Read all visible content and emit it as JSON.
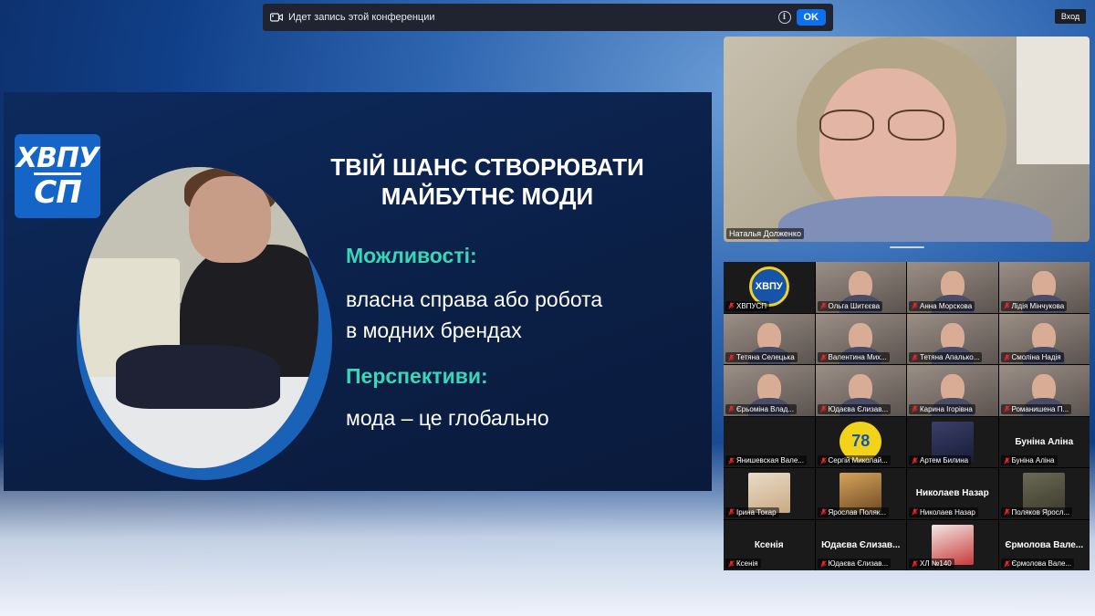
{
  "banner": {
    "text": "Идет запись этой конференции",
    "ok_label": "OK"
  },
  "login_label": "Вход",
  "slide": {
    "logo_line1": "ХВПУ",
    "logo_line2": "СП",
    "title_line1": "Твій шанс створювати",
    "title_line2": "майбутнє моди",
    "heading1": "Можливості:",
    "text1_line1": "власна справа або робота",
    "text1_line2": "в модних брендах",
    "heading2": "Перспективи:",
    "text2": "мода – це глобально"
  },
  "speaker": {
    "name": "Наталья Долженко"
  },
  "gallery": [
    {
      "name": "ХВПУСП",
      "kind": "logo"
    },
    {
      "name": "Ольга Шитєєва",
      "kind": "photo"
    },
    {
      "name": "Анна Морскова",
      "kind": "photo"
    },
    {
      "name": "Лідія Мінчукова",
      "kind": "photo"
    },
    {
      "name": "Тетяна Селецька",
      "kind": "photo"
    },
    {
      "name": "Валентина Мих...",
      "kind": "photo"
    },
    {
      "name": "Тетяна Апалько...",
      "kind": "photo"
    },
    {
      "name": "Смоліна Надія",
      "kind": "photo"
    },
    {
      "name": "Єрьоміна Влад...",
      "kind": "photo"
    },
    {
      "name": "Юдаєва Єлизав...",
      "kind": "photo"
    },
    {
      "name": "Карина Ігорівна",
      "kind": "photo"
    },
    {
      "name": "Романишена П...",
      "kind": "photo"
    },
    {
      "name": "Янишевская Вале...",
      "kind": "blank"
    },
    {
      "name": "Сергій Миколай...",
      "kind": "badge",
      "badge_text": "78"
    },
    {
      "name": "Артем Билина",
      "kind": "wolf"
    },
    {
      "name": "Буніна Аліна",
      "kind": "text",
      "center": "Буніна Аліна"
    },
    {
      "name": "Ірина Токар",
      "kind": "avatar-light"
    },
    {
      "name": "Ярослав Поляк...",
      "kind": "dog"
    },
    {
      "name": "Николаев Назар",
      "kind": "text",
      "center": "Николаев Назар"
    },
    {
      "name": "Поляков Яросл...",
      "kind": "camo"
    },
    {
      "name": "Ксенія",
      "kind": "text",
      "center": "Ксенія"
    },
    {
      "name": "Юдаєва Єлизав...",
      "kind": "text",
      "center": "Юдаєва Єлизав..."
    },
    {
      "name": "ХЛ №140",
      "kind": "avatar-red"
    },
    {
      "name": "Єрмолова Вале...",
      "kind": "text",
      "center": "Єрмолова Вале..."
    }
  ]
}
